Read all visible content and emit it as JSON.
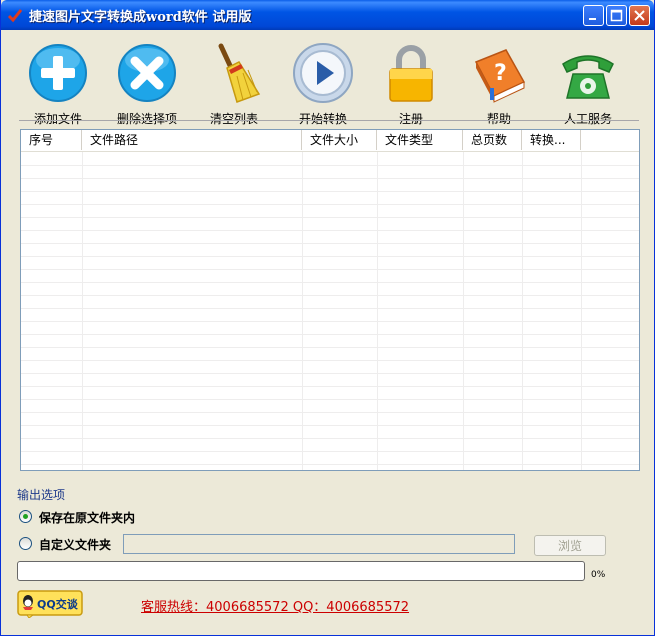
{
  "window": {
    "title": "捷速图片文字转换成word软件 试用版"
  },
  "toolbar": {
    "add_file": "添加文件",
    "delete_selected": "删除选择项",
    "clear_list": "清空列表",
    "start_convert": "开始转换",
    "register": "注册",
    "help": "帮助",
    "human_service": "人工服务"
  },
  "table": {
    "columns": [
      "序号",
      "文件路径",
      "文件大小",
      "文件类型",
      "总页数",
      "转换..."
    ],
    "rows": []
  },
  "output_options": {
    "title": "输出选项",
    "save_in_source": "保存在原文件夹内",
    "custom_folder": "自定义文件夹",
    "custom_folder_value": "",
    "browse": "浏览",
    "selected": "save_in_source"
  },
  "progress": {
    "value": 0,
    "label": "0%"
  },
  "footer": {
    "qq_button": "QQ交谈",
    "hotline": "客服热线：4006685572 QQ：4006685572"
  },
  "colors": {
    "titlebar": "#0055e5",
    "window_bg": "#ece9d8",
    "hotline": "#cc0000"
  },
  "icons": {
    "add_file": "plus-circle-icon",
    "delete_selected": "x-circle-icon",
    "clear_list": "broom-icon",
    "start_convert": "play-circle-icon",
    "register": "padlock-icon",
    "help": "help-book-icon",
    "human_service": "telephone-icon"
  }
}
